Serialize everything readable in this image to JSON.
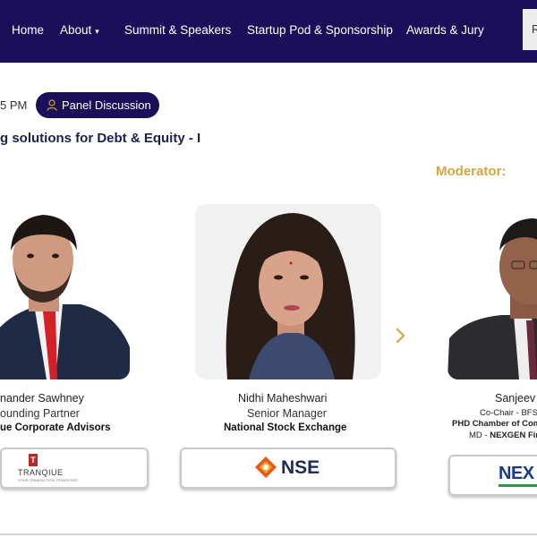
{
  "nav": {
    "items": [
      "Home",
      "About",
      "Summit & Speakers",
      "Startup Pod & Sponsorship",
      "Awards & Jury"
    ],
    "about_caret": "▾",
    "cta_partial": "R"
  },
  "session": {
    "time_partial": "5 PM",
    "pill_label": "Panel Discussion",
    "title": "g solutions for Debt & Equity - I",
    "moderator_heading": "Moderator:"
  },
  "speakers": [
    {
      "name": "nander Sawhney",
      "role": "ounding Partner",
      "org": "ue Corporate Advisors",
      "logo_text": "TRANQIUE",
      "logo_tagline": "YOUR TRANSACTION STRATEGIST",
      "logo_mark": "T"
    },
    {
      "name": "Nidhi Maheshwari",
      "role": "Senior Manager",
      "org": "National Stock Exchange",
      "logo_text": "NSE"
    },
    {
      "name": "Sanjeev",
      "role": "Co-Chair - BFS",
      "org": "PHD Chamber of Com",
      "md_prefix": "MD - ",
      "md_org": "NEXGEN Fin",
      "logo_text": "NEX"
    }
  ],
  "colors": {
    "nav_bg": "#1b0f5a",
    "accent_gold": "#d4a640",
    "nse_orange": "#e35a1c"
  },
  "icons": {
    "pill_icon": "user-icon",
    "carousel_next": "chevron-right-icon"
  }
}
